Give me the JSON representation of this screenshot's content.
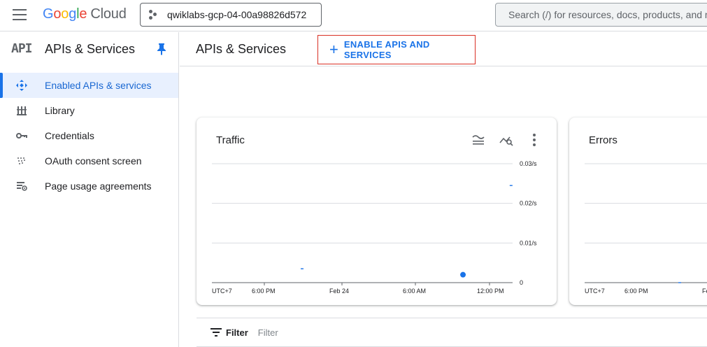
{
  "header": {
    "logo_google": [
      "G",
      "o",
      "o",
      "g",
      "l",
      "e"
    ],
    "logo_cloud": "Cloud",
    "project_name": "qwiklabs-gcp-04-00a98826d572",
    "search_placeholder": "Search (/) for resources, docs, products, and more"
  },
  "sidebar": {
    "logo_text": "API",
    "title": "APIs & Services",
    "items": [
      {
        "label": "Enabled APIs & services",
        "icon": "diamond-arrows-icon",
        "active": true
      },
      {
        "label": "Library",
        "icon": "library-icon",
        "active": false
      },
      {
        "label": "Credentials",
        "icon": "key-icon",
        "active": false
      },
      {
        "label": "OAuth consent screen",
        "icon": "oauth-dots-icon",
        "active": false
      },
      {
        "label": "Page usage agreements",
        "icon": "settings-list-icon",
        "active": false
      }
    ]
  },
  "main": {
    "title": "APIs & Services",
    "enable_button": "ENABLE APIS AND SERVICES"
  },
  "colors": {
    "accent": "#1a73e8",
    "active_bg": "#e8f0fe",
    "highlight_border": "#d93025"
  },
  "chart_data": [
    {
      "type": "scatter",
      "title": "Traffic",
      "y_ticks": [
        "0.03/s",
        "0.02/s",
        "0.01/s",
        "0"
      ],
      "ylim": [
        0,
        0.03
      ],
      "x_ticks": [
        "UTC+7",
        "6:00 PM",
        "Feb 24",
        "6:00 AM",
        "12:00 PM"
      ],
      "grid": true,
      "points": [
        {
          "x_pos": 0.3,
          "y": 0.0035
        },
        {
          "x_pos": 0.835,
          "y": 0.002
        },
        {
          "x_pos": 0.995,
          "y": 0.0245
        }
      ]
    },
    {
      "type": "line",
      "title": "Errors",
      "x_ticks": [
        "UTC+7",
        "6:00 PM",
        "Fe"
      ],
      "grid": true
    }
  ],
  "filter": {
    "label": "Filter",
    "placeholder": "Filter"
  }
}
